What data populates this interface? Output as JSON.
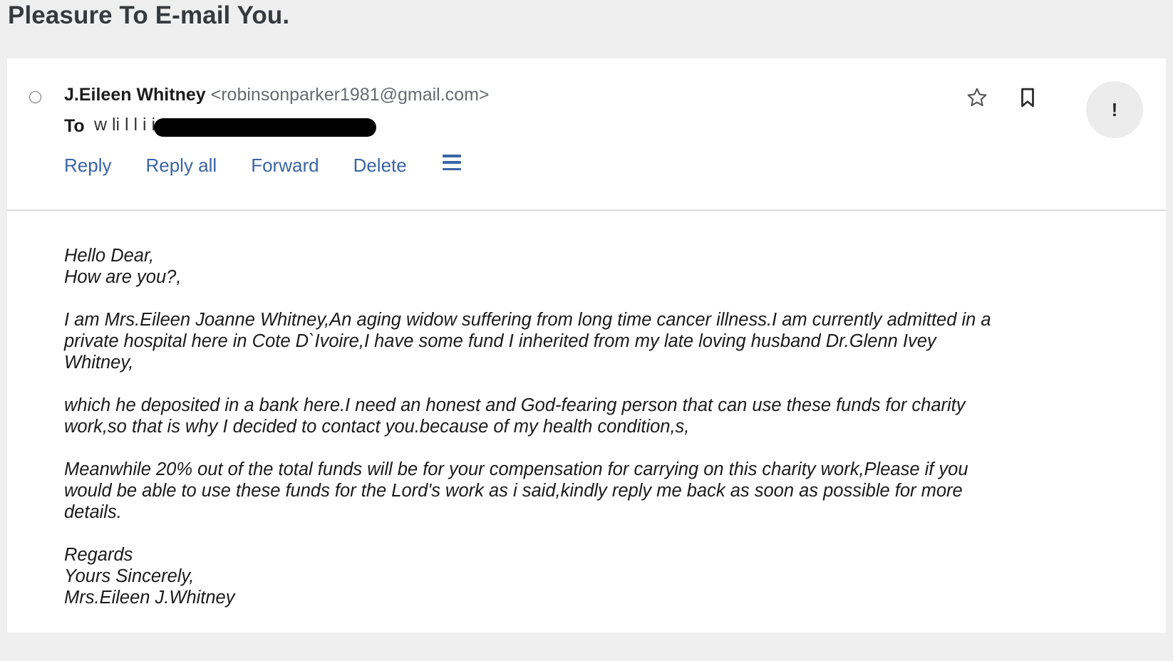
{
  "subject": "Pleasure To E-mail You.",
  "message": {
    "sender_name": "J.Eileen Whitney",
    "sender_email": "<robinsonparker1981@gmail.com>",
    "to_label": "To",
    "to_visible_fragment": "w   li  l    l    i i  t",
    "actions": {
      "reply": "Reply",
      "reply_all": "Reply all",
      "forward": "Forward",
      "delete": "Delete"
    },
    "icons": {
      "select": "radio-circle-icon",
      "more": "hamburger-menu-icon",
      "star": "star-outline-icon",
      "bookmark": "bookmark-outline-icon",
      "important": "exclamation-icon"
    },
    "important_glyph": "!",
    "body": {
      "greeting_1": "Hello Dear,",
      "greeting_2": "How are you?,",
      "para_1_line_1": "I am Mrs.Eileen Joanne Whitney,An aging widow suffering from long time cancer illness.I am currently admitted in a",
      "para_1_line_2": "private hospital here in Cote D`Ivoire,I have some fund I inherited from my late loving husband Dr.Glenn Ivey",
      "para_1_line_3": "Whitney,",
      "para_2_line_1": "which he deposited in a bank here.I need an honest and God-fearing person that can use these funds for charity",
      "para_2_line_2": "work,so that is why I decided to contact you.because of my health condition,s,",
      "para_3_line_1": "Meanwhile 20% out of the total funds will be for your compensation for carrying on this charity work,Please if you",
      "para_3_line_2": "would be able to use these funds for the Lord's work as i said,kindly reply me back as soon as possible for more",
      "para_3_line_3": "details.",
      "closing_1": "Regards",
      "closing_2": "Yours Sincerely,",
      "closing_3": "Mrs.Eileen J.Whitney"
    }
  },
  "colors": {
    "page_background": "#efefef",
    "card_background": "#ffffff",
    "link_blue": "#3a64a5",
    "sender_email_gray": "#666a70",
    "redaction": "#000000"
  }
}
